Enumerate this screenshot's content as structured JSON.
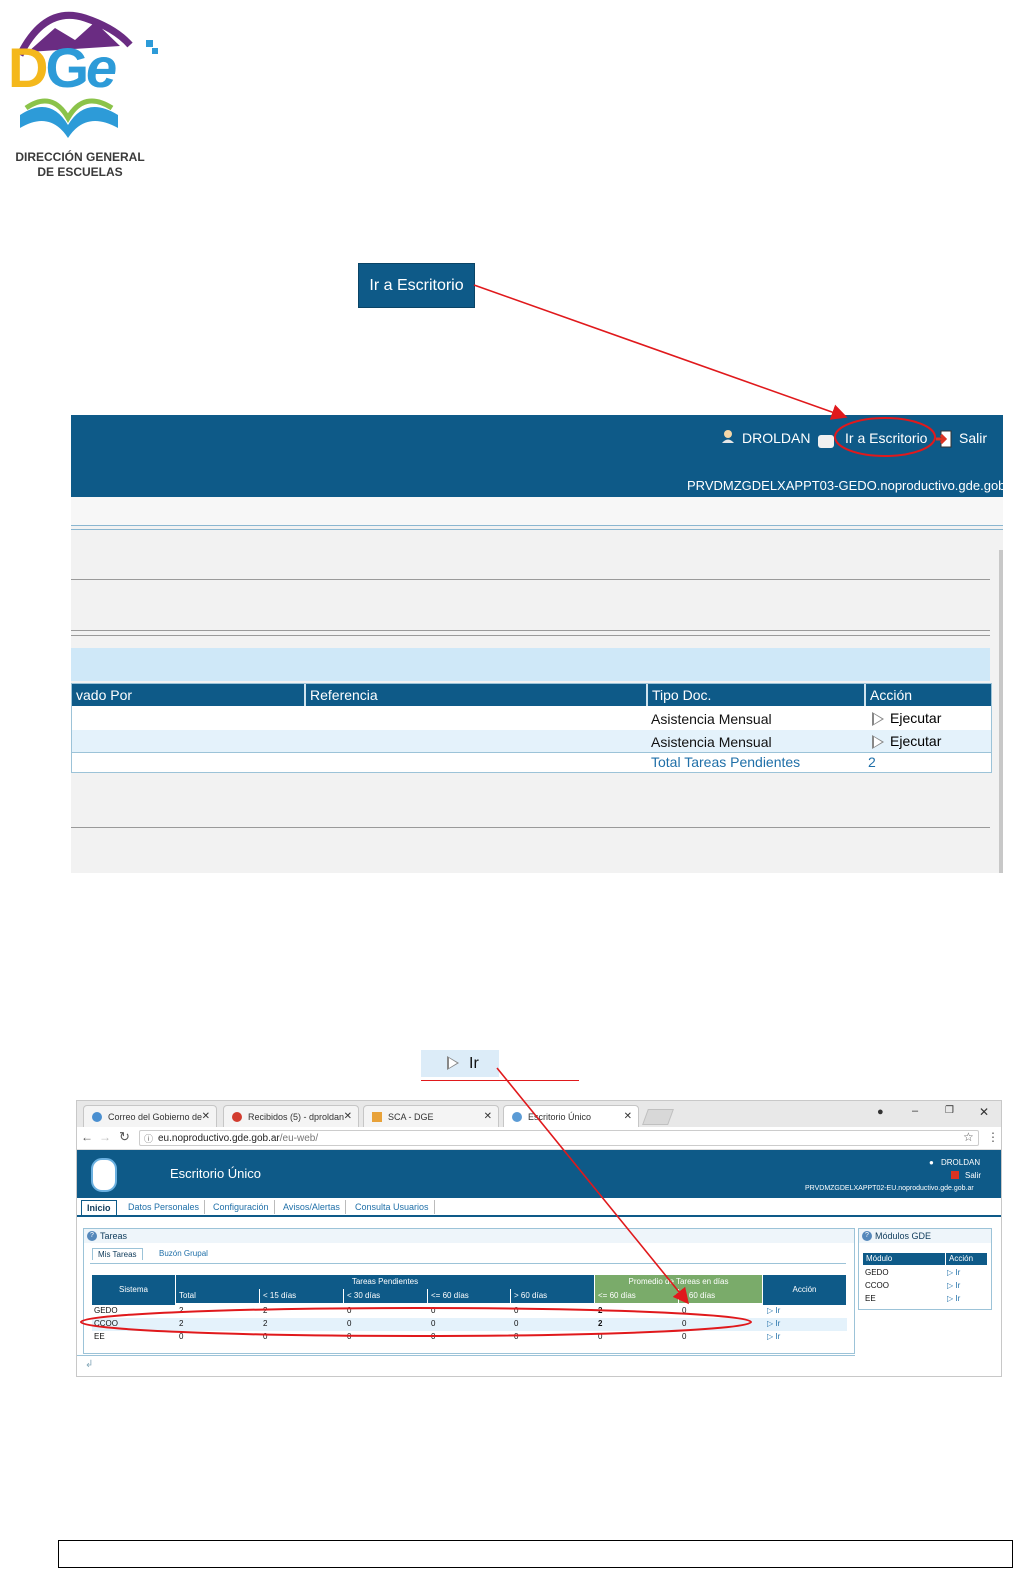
{
  "logo": {
    "wordmark": "DGe",
    "line1": "DIRECCIÓN GENERAL",
    "line2": "DE ESCUELAS"
  },
  "callouts": {
    "escritorio_button": "Ir a Escritorio",
    "ir_button": "Ir"
  },
  "screen1": {
    "user": "DROLDAN",
    "escritorio_link": "Ir a Escritorio",
    "salir": "Salir",
    "host": "PRVDMZGDELXAPPT03-GEDO.noproductivo.gde.gob.",
    "columns": [
      "vado Por",
      "Referencia",
      "Tipo Doc.",
      "Acción"
    ],
    "rows": [
      {
        "tipo": "Asistencia Mensual",
        "accion": "Ejecutar"
      },
      {
        "tipo": "Asistencia Mensual",
        "accion": "Ejecutar"
      }
    ],
    "total_label": "Total Tareas Pendientes",
    "total_value": "2"
  },
  "screen2": {
    "browser_tabs": [
      {
        "label": "Correo del Gobierno de",
        "color": "#4a8fd0"
      },
      {
        "label": "Recibidos (5) - dproldan",
        "color": "#d23c2f"
      },
      {
        "label": "SCA - DGE",
        "color": "#e8a23a"
      },
      {
        "label": "Escritorio Único",
        "color": "#5b9bd5"
      }
    ],
    "url_domain": "eu.noproductivo.gde.gob.ar",
    "url_path": "/eu-web/",
    "app_title": "Escritorio Único",
    "user": "DROLDAN",
    "salir": "Salir",
    "host": "PRVDMZGDELXAPPT02-EU.noproductivo.gde.gob.ar",
    "menu": [
      "Inicio",
      "Datos Personales",
      "Configuración",
      "Avisos/Alertas",
      "Consulta Usuarios"
    ],
    "tareas_title": "Tareas",
    "subtabs": [
      "Mis Tareas",
      "Buzón Grupal"
    ],
    "group_pendientes": "Tareas Pendientes",
    "group_promedio": "Promedio de Tareas en días",
    "col_sistema": "Sistema",
    "col_accion": "Acción",
    "subcols": [
      "Total",
      "< 15 días",
      "< 30 días",
      "<= 60 días",
      "> 60 días",
      "<= 60 días",
      "> 60 días"
    ],
    "rows": [
      {
        "sistema": "GEDO",
        "vals": [
          "2",
          "2",
          "0",
          "0",
          "0",
          "2",
          "0"
        ],
        "accion": "Ir"
      },
      {
        "sistema": "CCOO",
        "vals": [
          "2",
          "2",
          "0",
          "0",
          "0",
          "2",
          "0"
        ],
        "accion": "Ir"
      },
      {
        "sistema": "EE",
        "vals": [
          "0",
          "0",
          "0",
          "0",
          "0",
          "0",
          "0"
        ],
        "accion": "Ir"
      }
    ],
    "modulos_title": "Módulos GDE",
    "modulos_cols": [
      "Módulo",
      "Acción"
    ],
    "modulos": [
      {
        "name": "GEDO",
        "accion": "Ir"
      },
      {
        "name": "CCOO",
        "accion": "Ir"
      },
      {
        "name": "EE",
        "accion": "Ir"
      }
    ]
  },
  "colors": {
    "primary": "#0e5a88",
    "annotation": "#e0191c",
    "green_header": "#7aab6a"
  }
}
